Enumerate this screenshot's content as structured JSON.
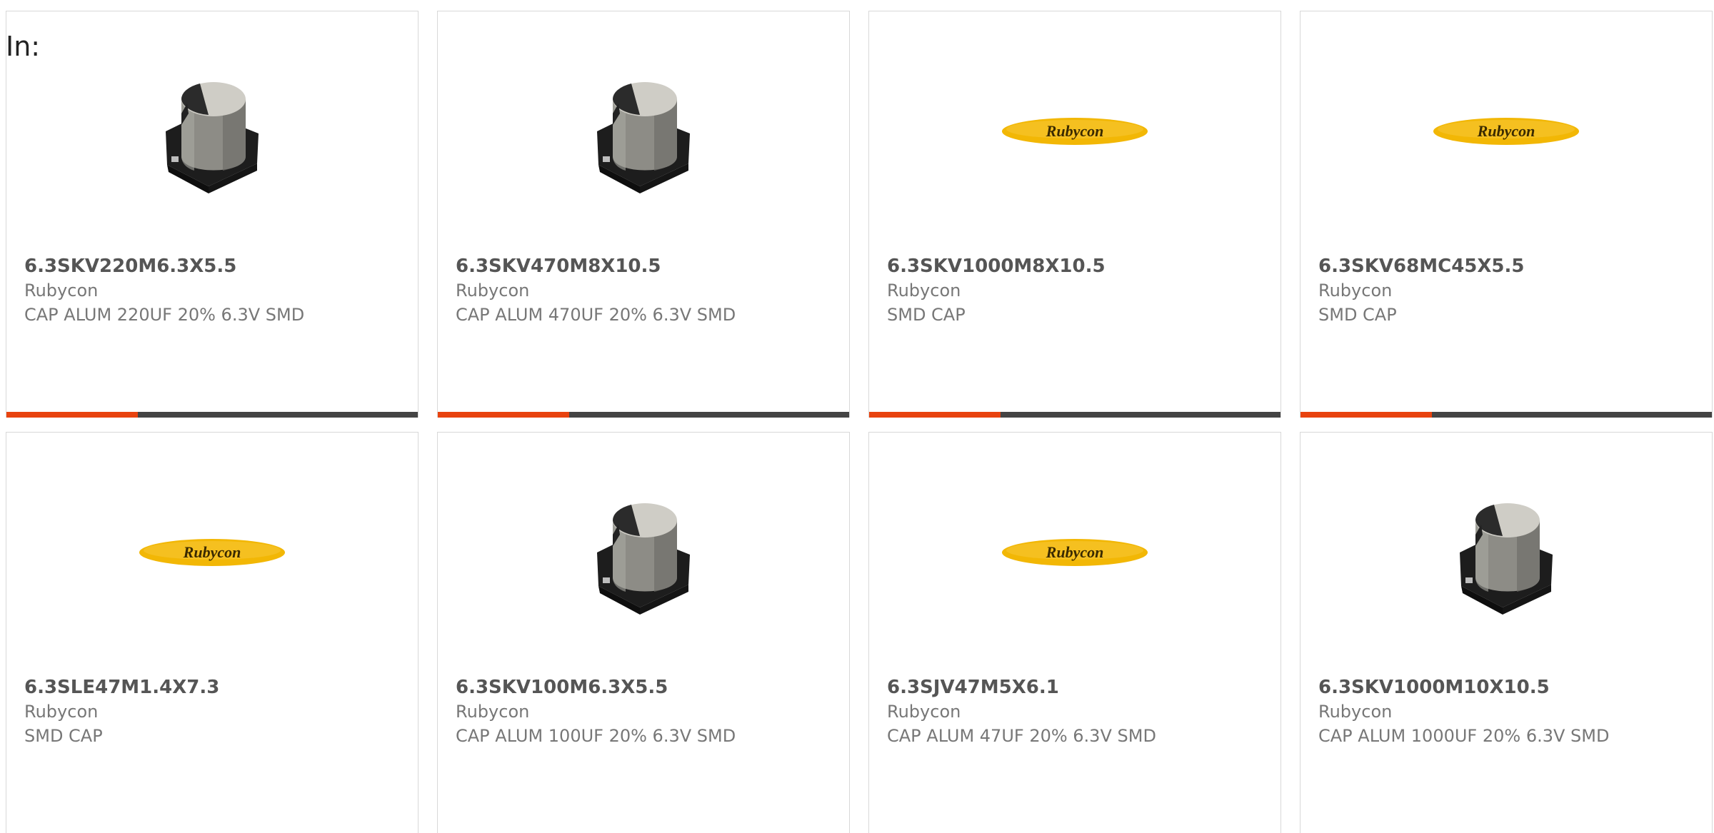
{
  "filter_label": "In:",
  "products": [
    {
      "part": "6.3SKV220M6.3X5.5",
      "mfr": "Rubycon",
      "desc": "CAP ALUM 220UF 20% 6.3V SMD",
      "image": "capacitor",
      "progress": 0.32
    },
    {
      "part": "6.3SKV470M8X10.5",
      "mfr": "Rubycon",
      "desc": "CAP ALUM 470UF 20% 6.3V SMD",
      "image": "capacitor",
      "progress": 0.32
    },
    {
      "part": "6.3SKV1000M8X10.5",
      "mfr": "Rubycon",
      "desc": "SMD CAP",
      "image": "logo",
      "progress": 0.32
    },
    {
      "part": "6.3SKV68MC45X5.5",
      "mfr": "Rubycon",
      "desc": "SMD CAP",
      "image": "logo",
      "progress": 0.32
    },
    {
      "part": "6.3SLE47M1.4X7.3",
      "mfr": "Rubycon",
      "desc": "SMD CAP",
      "image": "logo",
      "progress": null
    },
    {
      "part": "6.3SKV100M6.3X5.5",
      "mfr": "Rubycon",
      "desc": "CAP ALUM 100UF 20% 6.3V SMD",
      "image": "capacitor",
      "progress": null
    },
    {
      "part": "6.3SJV47M5X6.1",
      "mfr": "Rubycon",
      "desc": "CAP ALUM 47UF 20% 6.3V SMD",
      "image": "logo",
      "progress": null
    },
    {
      "part": "6.3SKV1000M10X10.5",
      "mfr": "Rubycon",
      "desc": "CAP ALUM 1000UF 20% 6.3V SMD",
      "image": "capacitor",
      "progress": null
    }
  ],
  "logo_text": "Rubycon",
  "colors": {
    "accent": "#e8430f",
    "bar": "#444444",
    "logo_yellow": "#f2b705"
  }
}
